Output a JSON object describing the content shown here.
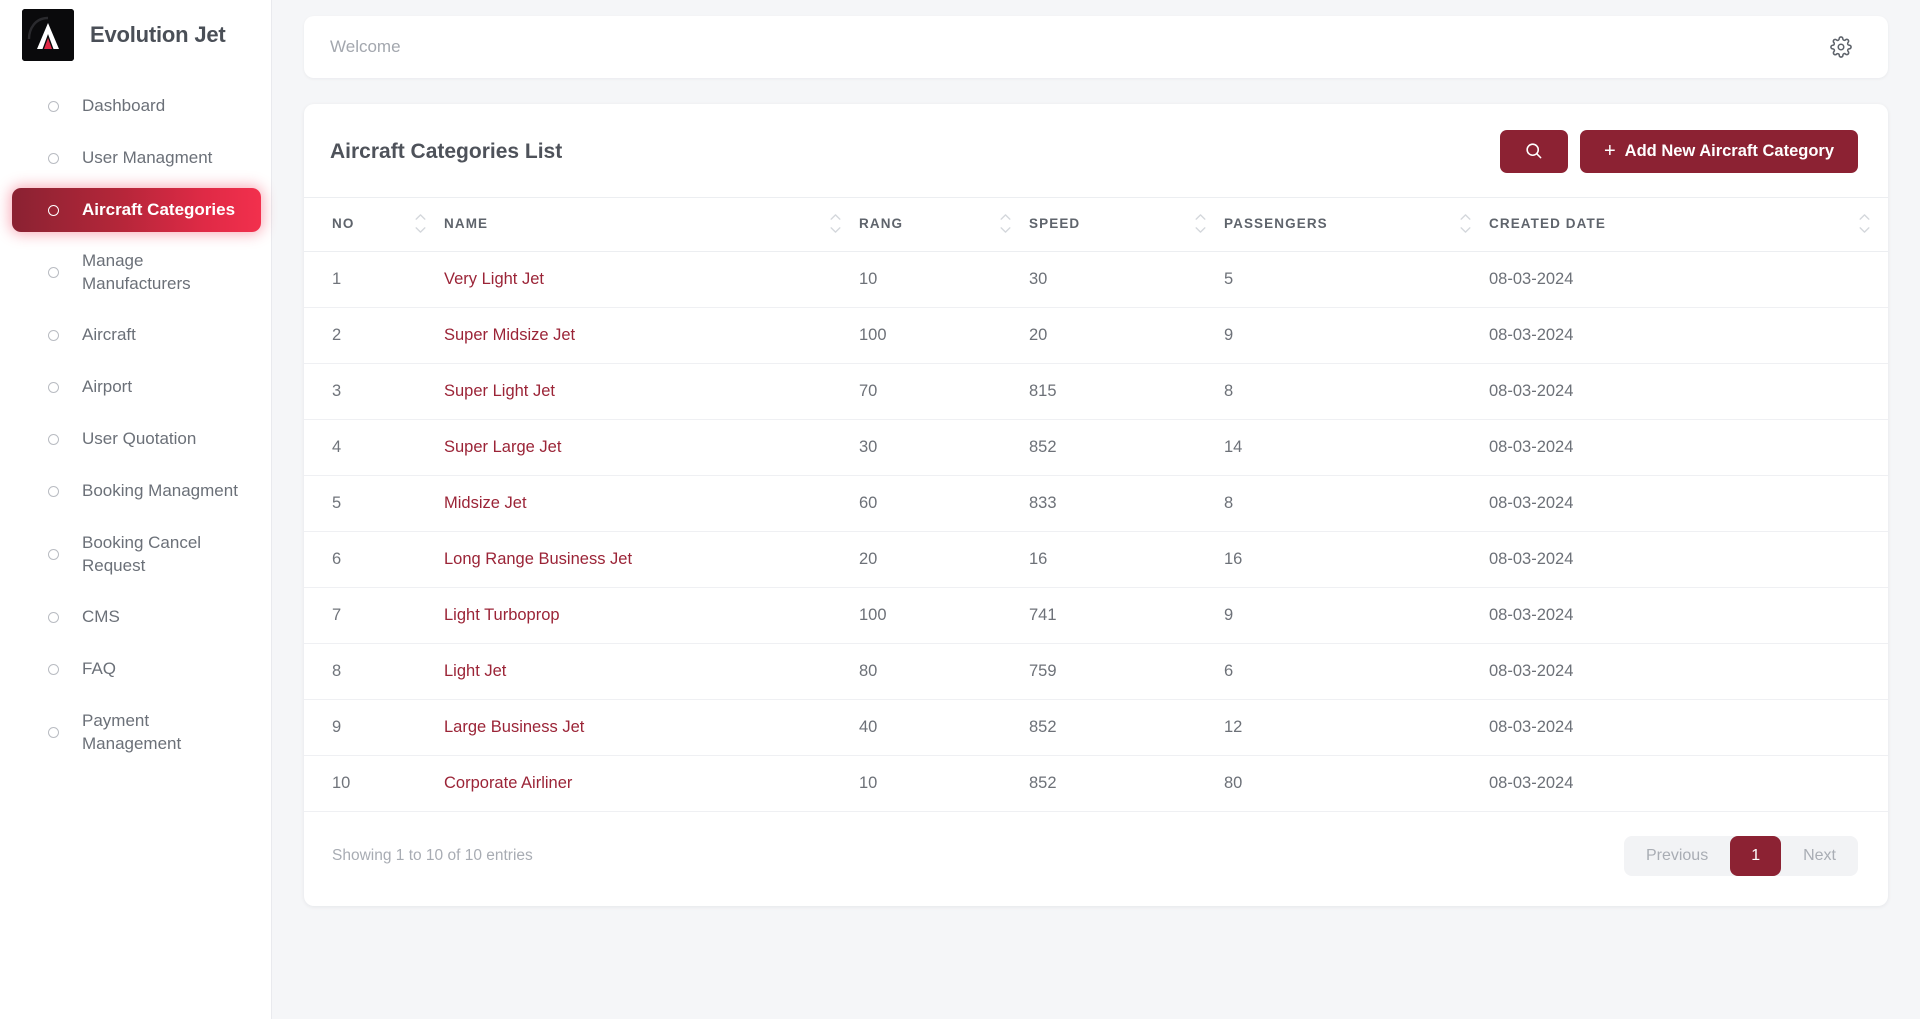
{
  "sidebar": {
    "brand_name": "Evolution Jet",
    "logo_icon": "lambda-logo-icon",
    "items": [
      {
        "label": "Dashboard",
        "active": false
      },
      {
        "label": "User Managment",
        "active": false
      },
      {
        "label": "Aircraft Categories",
        "active": true
      },
      {
        "label": "Manage Manufacturers",
        "active": false
      },
      {
        "label": "Aircraft",
        "active": false
      },
      {
        "label": "Airport",
        "active": false
      },
      {
        "label": "User Quotation",
        "active": false
      },
      {
        "label": "Booking Managment",
        "active": false
      },
      {
        "label": "Booking Cancel Request",
        "active": false
      },
      {
        "label": "CMS",
        "active": false
      },
      {
        "label": "FAQ",
        "active": false
      },
      {
        "label": "Payment Management",
        "active": false
      }
    ]
  },
  "topbar": {
    "welcome": "Welcome",
    "settings_icon": "gear-icon"
  },
  "card": {
    "title": "Aircraft Categories List",
    "search_icon": "search-icon",
    "add_button_label": "Add New Aircraft Category",
    "add_button_plus": "+"
  },
  "table": {
    "columns": [
      {
        "key": "no",
        "label": "NO",
        "sortable": true
      },
      {
        "key": "name",
        "label": "NAME",
        "sortable": true
      },
      {
        "key": "rang",
        "label": "RANG",
        "sortable": true
      },
      {
        "key": "speed",
        "label": "SPEED",
        "sortable": true
      },
      {
        "key": "passengers",
        "label": "PASSENGERS",
        "sortable": true
      },
      {
        "key": "created_date",
        "label": "CREATED DATE",
        "sortable": true
      }
    ],
    "rows": [
      {
        "no": "1",
        "name": "Very Light Jet",
        "rang": "10",
        "speed": "30",
        "passengers": "5",
        "created_date": "08-03-2024"
      },
      {
        "no": "2",
        "name": "Super Midsize Jet",
        "rang": "100",
        "speed": "20",
        "passengers": "9",
        "created_date": "08-03-2024"
      },
      {
        "no": "3",
        "name": "Super Light Jet",
        "rang": "70",
        "speed": "815",
        "passengers": "8",
        "created_date": "08-03-2024"
      },
      {
        "no": "4",
        "name": "Super Large Jet",
        "rang": "30",
        "speed": "852",
        "passengers": "14",
        "created_date": "08-03-2024"
      },
      {
        "no": "5",
        "name": "Midsize Jet",
        "rang": "60",
        "speed": "833",
        "passengers": "8",
        "created_date": "08-03-2024"
      },
      {
        "no": "6",
        "name": "Long Range Business Jet",
        "rang": "20",
        "speed": "16",
        "passengers": "16",
        "created_date": "08-03-2024"
      },
      {
        "no": "7",
        "name": "Light Turboprop",
        "rang": "100",
        "speed": "741",
        "passengers": "9",
        "created_date": "08-03-2024"
      },
      {
        "no": "8",
        "name": "Light Jet",
        "rang": "80",
        "speed": "759",
        "passengers": "6",
        "created_date": "08-03-2024"
      },
      {
        "no": "9",
        "name": "Large Business Jet",
        "rang": "40",
        "speed": "852",
        "passengers": "12",
        "created_date": "08-03-2024"
      },
      {
        "no": "10",
        "name": "Corporate Airliner",
        "rang": "10",
        "speed": "852",
        "passengers": "80",
        "created_date": "08-03-2024"
      }
    ]
  },
  "footer": {
    "entries_info": "Showing 1 to 10 of 10 entries",
    "previous_label": "Previous",
    "current_page": "1",
    "next_label": "Next"
  },
  "colors": {
    "brand_maroon": "#8c2233",
    "accent_red": "#f2304d",
    "link_red": "#9b2437",
    "page_bg": "#f5f6f8",
    "card_bg": "#ffffff"
  }
}
